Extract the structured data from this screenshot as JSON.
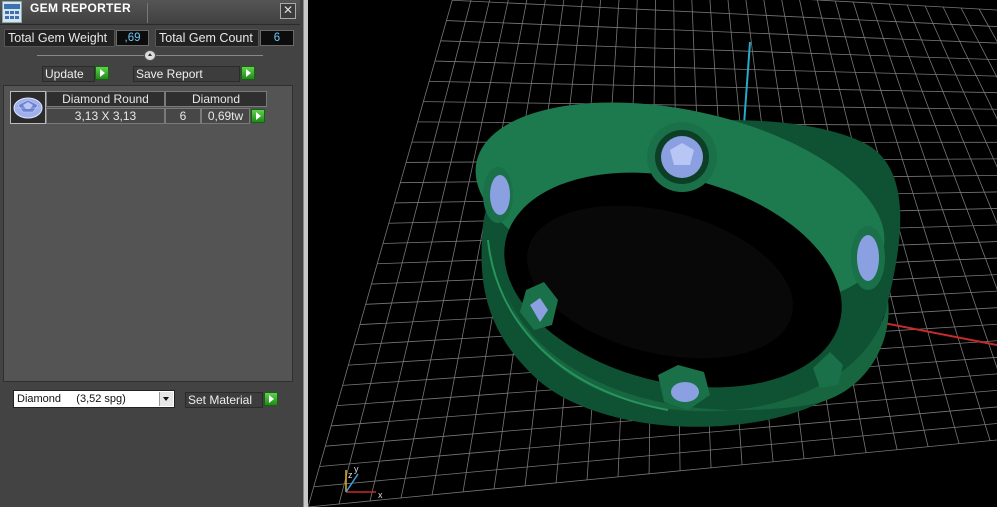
{
  "window": {
    "title": "GEM REPORTER",
    "close_glyph": "✕",
    "app_icon": "gem-reporter-icon"
  },
  "stats": {
    "total_weight_label": "Total Gem Weight",
    "total_weight_value": ",69",
    "total_count_label": "Total Gem Count",
    "total_count_value": "6"
  },
  "actions": {
    "update_label": "Update",
    "save_report_label": "Save Report"
  },
  "gem_table": {
    "headers": [
      "Diamond Round",
      "Diamond"
    ],
    "rows": [
      {
        "size": "3,13 X 3,13",
        "count": "6",
        "weight": "0,69tw"
      }
    ]
  },
  "material": {
    "selected": "Diamond     (3,52 spg)",
    "set_material_label": "Set Material"
  },
  "viewport": {
    "axis_labels": {
      "x": "x",
      "y": "y",
      "z": "z"
    },
    "colors": {
      "ring": "#1a6b46",
      "gem": "#8aa0e0",
      "grid": "#8c8c8c",
      "x_axis": "#c82a2a",
      "y_axis": "#2aa7c9"
    }
  }
}
